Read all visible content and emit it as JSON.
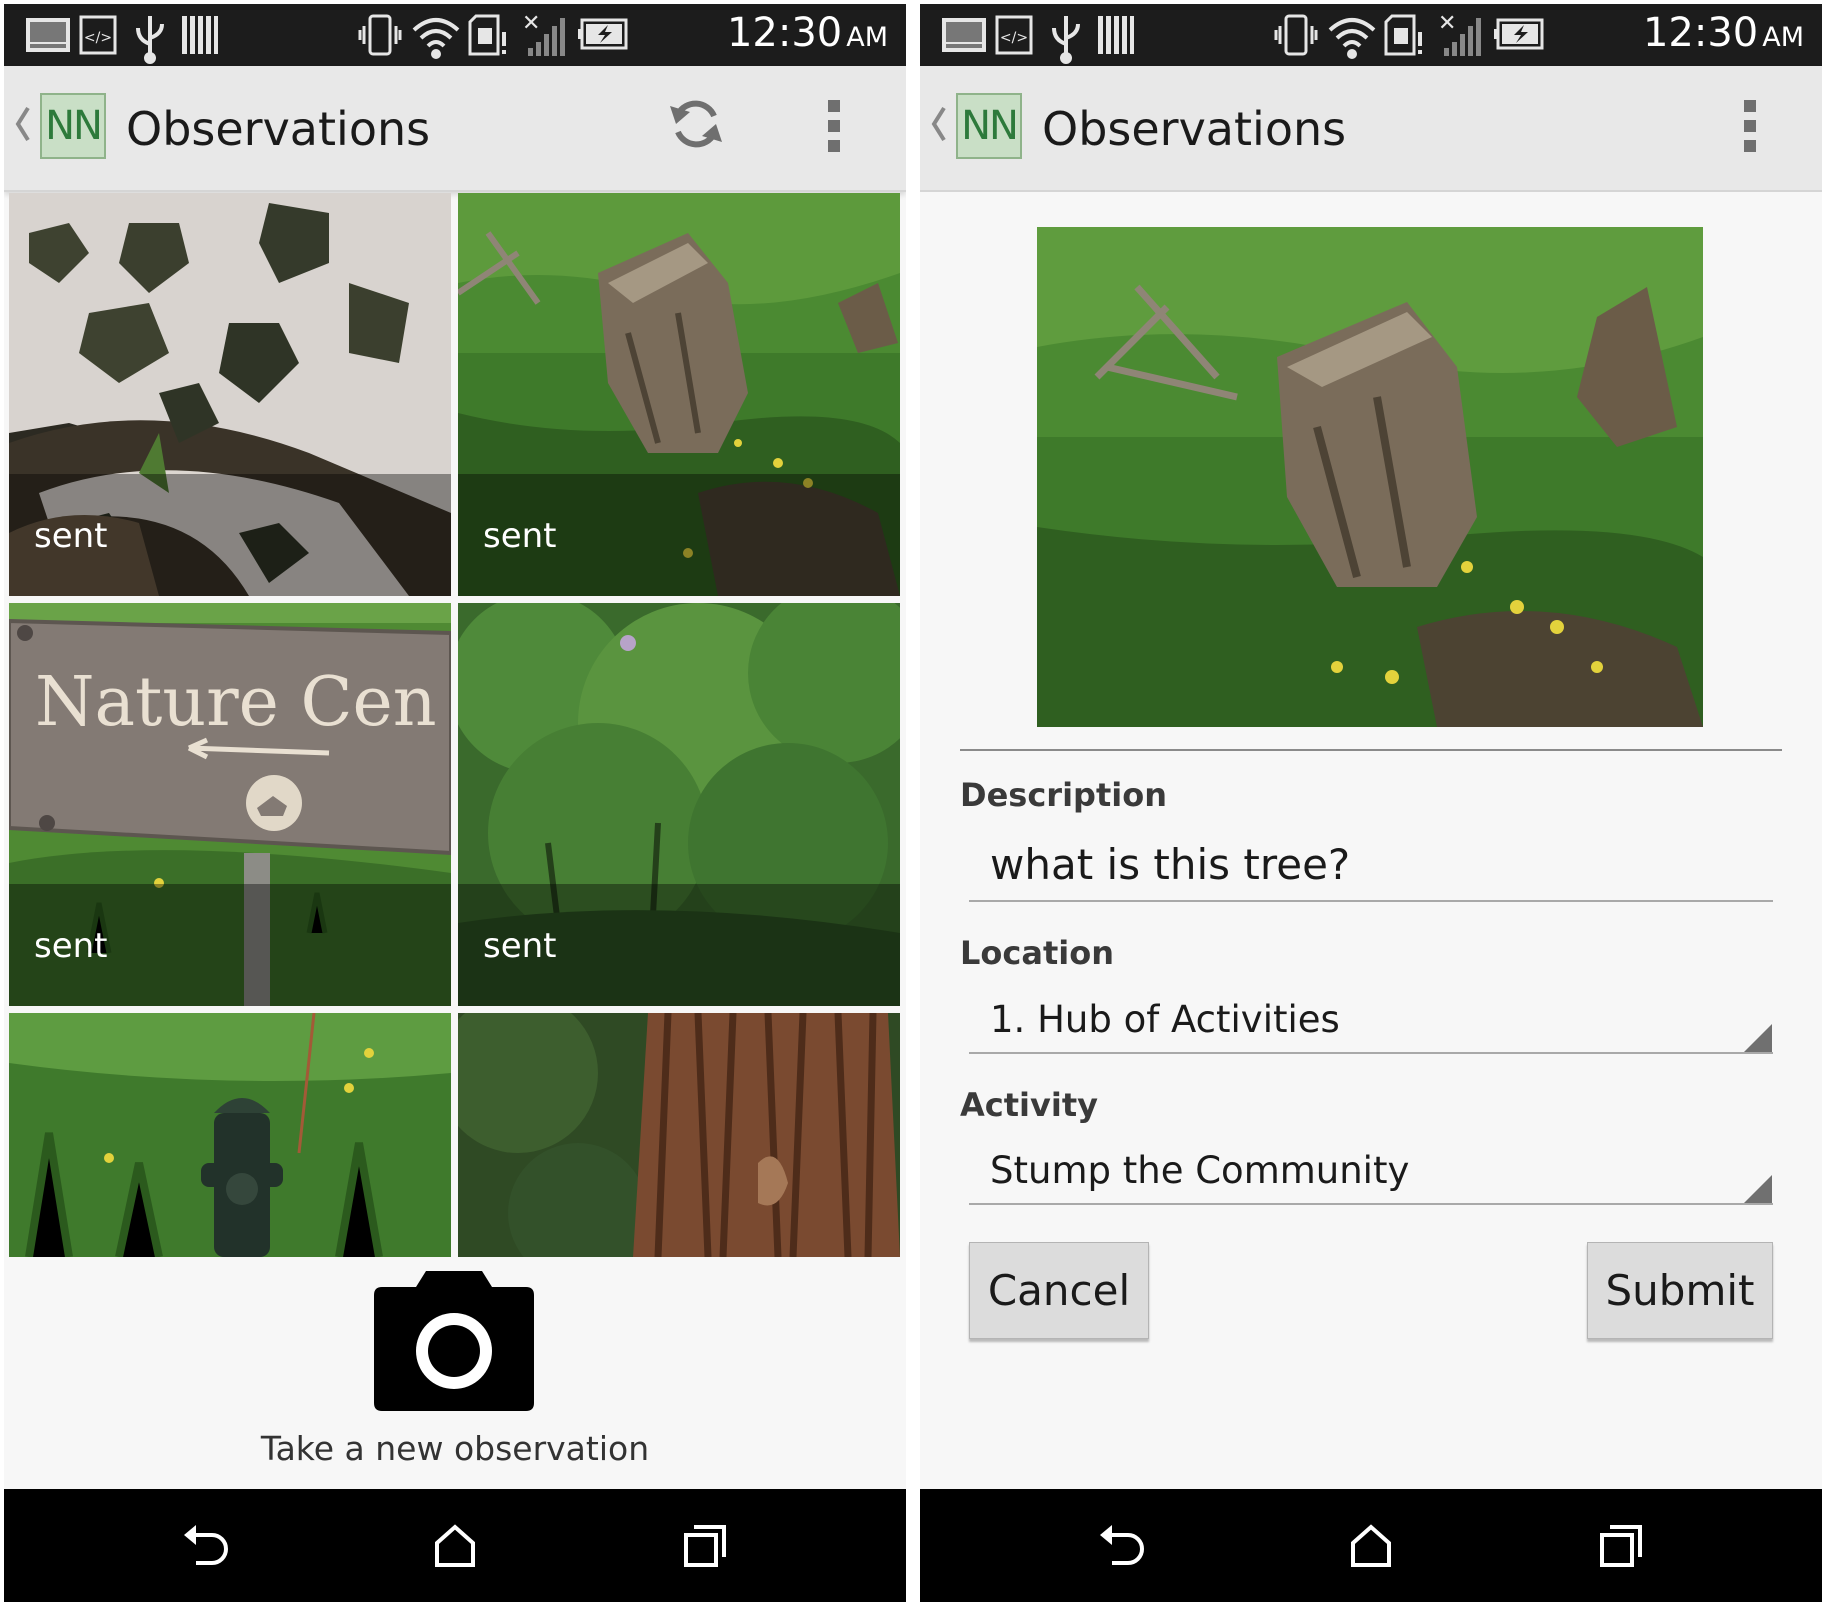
{
  "status_bar": {
    "time": "12:30",
    "ampm": "AM",
    "left_icons": [
      "gallery-icon",
      "code-icon",
      "usb-icon",
      "barcode-icon"
    ],
    "right_icons": [
      "vibrate-icon",
      "wifi-icon",
      "sd-card-alert-icon",
      "no-signal-icon",
      "battery-charging-icon"
    ]
  },
  "left_screen": {
    "action_bar": {
      "logo_text": "NN",
      "title": "Observations",
      "actions": [
        "refresh-icon",
        "overflow-menu-icon"
      ]
    },
    "observations": [
      {
        "status": "sent",
        "subject": "shadowed-rock"
      },
      {
        "status": "sent",
        "subject": "tree-stump"
      },
      {
        "status": "sent",
        "subject": "nature-center-sign"
      },
      {
        "status": "sent",
        "subject": "green-shrub"
      },
      {
        "status": "",
        "subject": "fire-hydrant"
      },
      {
        "status": "",
        "subject": "tree-bark"
      }
    ],
    "sign_text": "Nature Cen",
    "camera_caption": "Take a new observation"
  },
  "right_screen": {
    "action_bar": {
      "logo_text": "NN",
      "title": "Observations",
      "actions": [
        "overflow-menu-icon"
      ]
    },
    "form": {
      "description_label": "Description",
      "description_value": "what is this tree?",
      "location_label": "Location",
      "location_value": "1. Hub of Activities",
      "activity_label": "Activity",
      "activity_value": "Stump the Community",
      "cancel_label": "Cancel",
      "submit_label": "Submit"
    }
  },
  "nav_bar": {
    "buttons": [
      "back-icon",
      "home-icon",
      "recent-apps-icon"
    ]
  },
  "colors": {
    "status_bar": "#1c1c1c",
    "action_bar": "#e8e8e8",
    "logo_bg": "#c9dfc6",
    "logo_text": "#2d7a3b",
    "nav_bar": "#000000",
    "button_bg": "#dcdcdc"
  }
}
